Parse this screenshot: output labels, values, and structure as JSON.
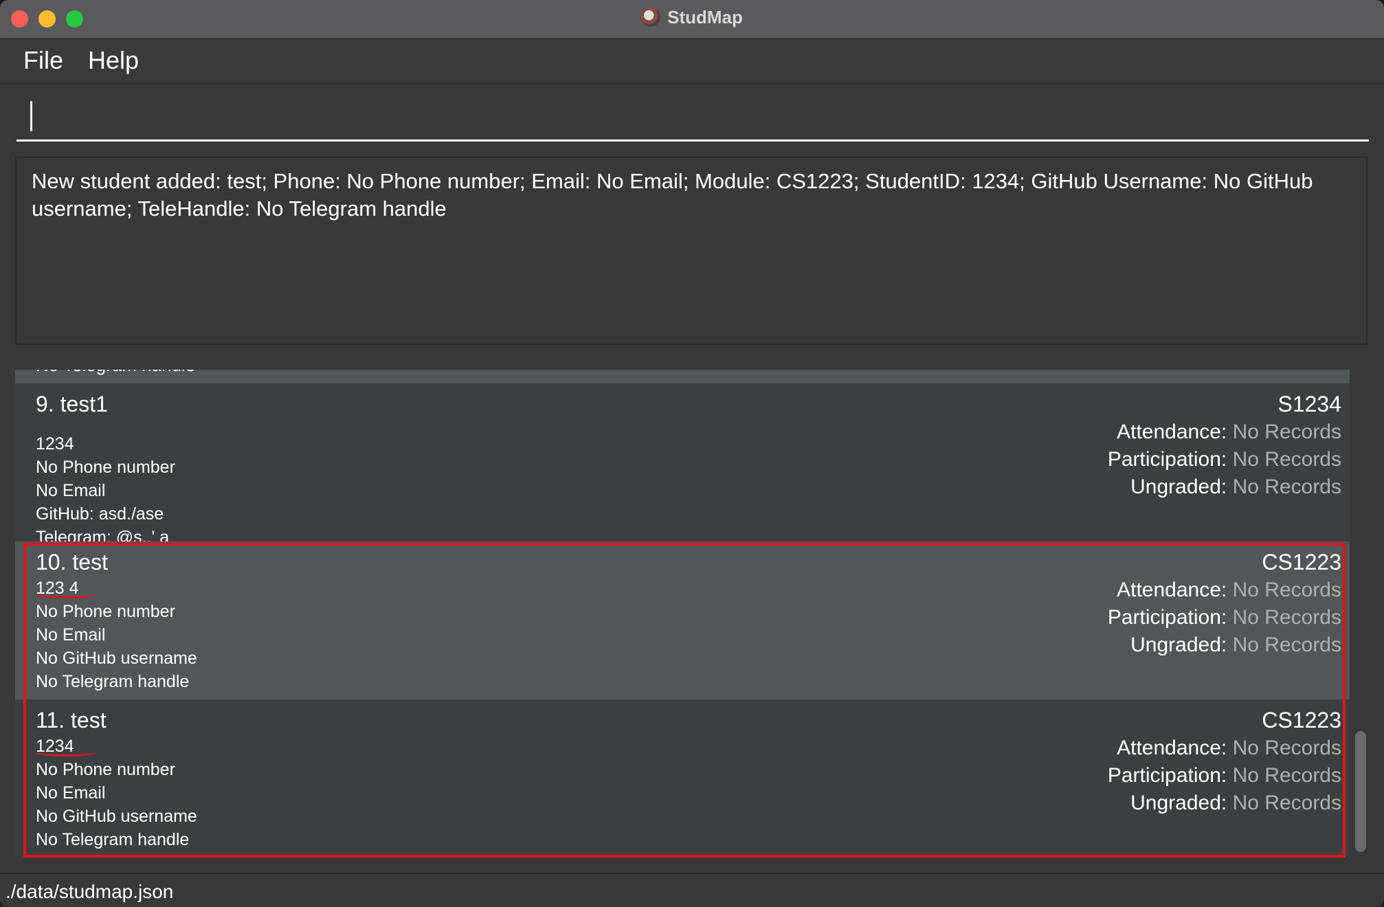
{
  "window": {
    "title": "StudMap"
  },
  "menu": {
    "items": [
      "File",
      "Help"
    ]
  },
  "command": {
    "value": ""
  },
  "result": {
    "text": "New student added: test; Phone: No Phone number; Email: No Email; Module: CS1223; StudentID: 1234; GitHub Username: No GitHub username; TeleHandle: No Telegram handle"
  },
  "list": {
    "partial_text": "No Telegram handle",
    "cards": [
      {
        "name": "9.  test1",
        "lines": [
          "1234",
          "No Phone number",
          "No Email",
          "GitHub: asd./ase",
          "Telegram: @s.,' a"
        ],
        "module": "S1234",
        "attendance_label": "Attendance:",
        "attendance": "No Records",
        "participation_label": "Participation:",
        "participation": "No Records",
        "ungraded_label": "Ungraded:",
        "ungraded": "No Records"
      },
      {
        "name": "10.  test",
        "lines": [
          "123 4",
          "No Phone number",
          "No Email",
          "No GitHub username",
          "No Telegram handle"
        ],
        "module": "CS1223",
        "attendance_label": "Attendance:",
        "attendance": "No Records",
        "participation_label": "Participation:",
        "participation": "No Records",
        "ungraded_label": "Ungraded:",
        "ungraded": "No Records"
      },
      {
        "name": "11.  test",
        "lines": [
          "1234",
          "No Phone number",
          "No Email",
          "No GitHub username",
          "No Telegram handle"
        ],
        "module": "CS1223",
        "attendance_label": "Attendance:",
        "attendance": "No Records",
        "participation_label": "Participation:",
        "participation": "No Records",
        "ungraded_label": "Ungraded:",
        "ungraded": "No Records"
      }
    ]
  },
  "status": {
    "path": "./data/studmap.json"
  },
  "colors": {
    "annotation": "#e0141c",
    "card_dark": "#3c3f41",
    "card_selected": "#515658"
  }
}
